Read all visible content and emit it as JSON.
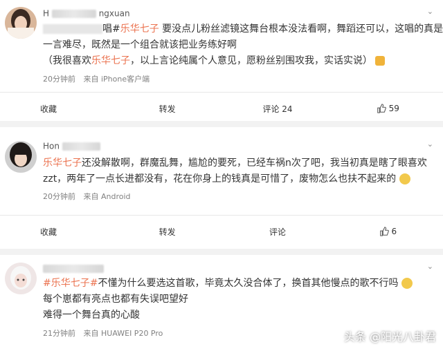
{
  "posts": [
    {
      "username_visible": "H",
      "username_tail": "ngxuan",
      "lines": [
        {
          "prefix_blur": true,
          "after_blur": "唱#",
          "tag": "乐华七子",
          "text": " 要没点儿粉丝滤镜这舞台根本没法看啊，舞蹈还可以，这唱的真是"
        },
        {
          "text": "一言难尽，既然是一个组合就该把业务练好啊"
        },
        {
          "pre": "（我很喜欢",
          "tag": "乐华七子",
          "text": "，以上言论纯属个人意见，愿粉丝别围攻我，实话实说）"
        }
      ],
      "time": "20分钟前",
      "source": "来自 iPhone客户端",
      "actions": {
        "collect": "收藏",
        "forward": "转发",
        "comment": "评论 24",
        "like": "59"
      }
    },
    {
      "username_visible": "Hon",
      "lines": [
        {
          "tag": "乐华七子",
          "text": "还没解散啊，群魔乱舞，尴尬的要死，已经车祸n次了吧，我当初真是瞎了眼喜欢"
        },
        {
          "text": "zzt，两年了一点长进都没有，花在你身上的钱真是可惜了，废物怎么也扶不起来的"
        }
      ],
      "time": "20分钟前",
      "source": "来自 Android",
      "actions": {
        "collect": "收藏",
        "forward": "转发",
        "comment": "评论",
        "like": "6"
      }
    },
    {
      "lines": [
        {
          "tag": "#乐华七子#",
          "text": "不懂为什么要选这首歌，毕竟太久没合体了，换首其他慢点的歌不行吗"
        },
        {
          "text": "每个崽都有亮点也都有失误吧望好"
        },
        {
          "text": "难得一个舞台真的心酸"
        }
      ],
      "time": "21分钟前",
      "source": "来自 HUAWEI P20 Pro"
    }
  ],
  "watermark": "头条 @阳光八卦君",
  "colors": {
    "tag": "#eb7350",
    "meta": "#808080",
    "background": "#f2f2f2"
  }
}
